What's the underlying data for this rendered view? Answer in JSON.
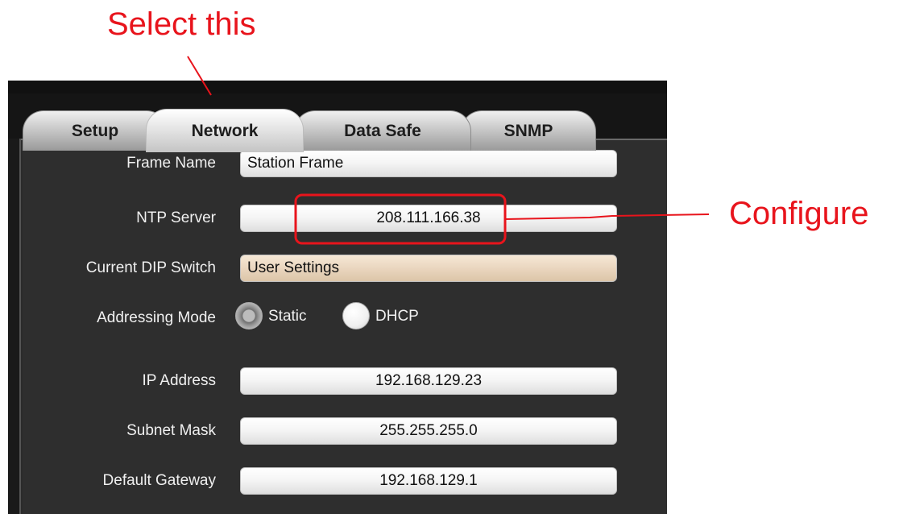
{
  "annotations": {
    "select_note": "Select this",
    "configure_note": "Configure",
    "color": "#e8141c"
  },
  "tabs": [
    {
      "label": "Setup",
      "selected": false
    },
    {
      "label": "Network",
      "selected": true
    },
    {
      "label": "Data Safe",
      "selected": false
    },
    {
      "label": "SNMP",
      "selected": false
    }
  ],
  "form": {
    "frame_name": {
      "label": "Frame Name",
      "value": "Station Frame"
    },
    "ntp_server": {
      "label": "NTP Server",
      "value": "208.111.166.38"
    },
    "dip_switch": {
      "label": "Current DIP Switch",
      "value": "User Settings"
    },
    "addressing_mode": {
      "label": "Addressing Mode",
      "options": [
        "Static",
        "DHCP"
      ],
      "selected": "Static"
    },
    "ip_address": {
      "label": "IP Address",
      "value": "192.168.129.23"
    },
    "subnet_mask": {
      "label": "Subnet Mask",
      "value": "255.255.255.0"
    },
    "default_gateway": {
      "label": "Default Gateway",
      "value": "192.168.129.1"
    }
  }
}
